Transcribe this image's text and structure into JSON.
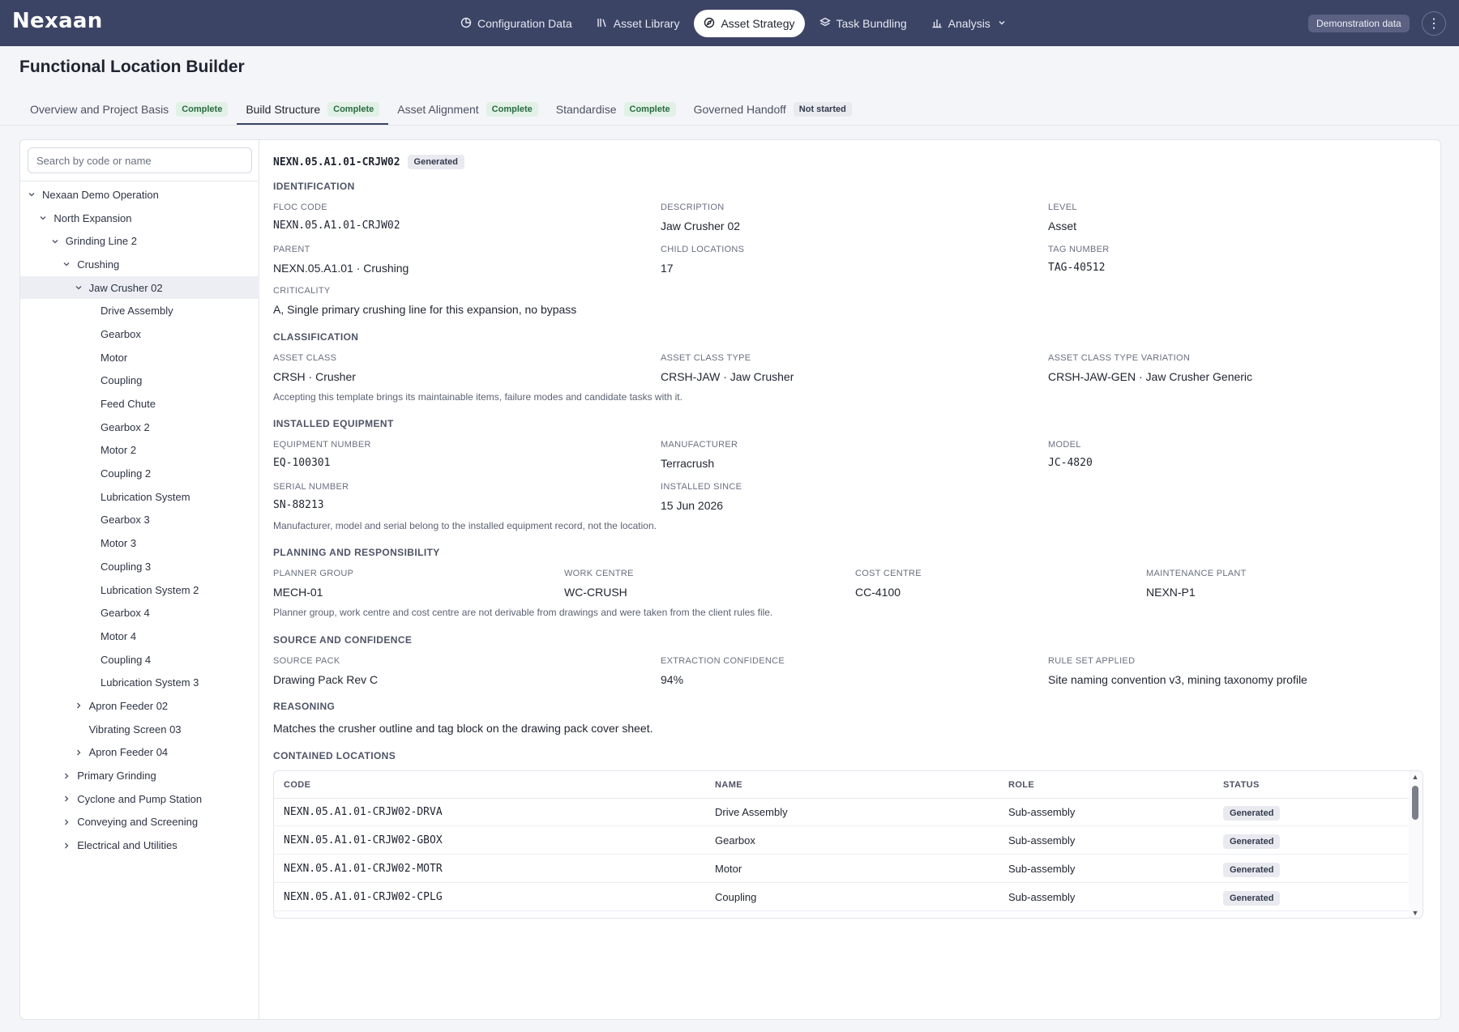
{
  "brand": "Nexaan",
  "nav": [
    {
      "label": "Configuration Data",
      "icon": "chart-pie-icon"
    },
    {
      "label": "Asset Library",
      "icon": "library-icon"
    },
    {
      "label": "Asset Strategy",
      "icon": "compass-icon"
    },
    {
      "label": "Task Bundling",
      "icon": "layers-icon"
    },
    {
      "label": "Analysis",
      "icon": "bar-chart-icon"
    }
  ],
  "demo_badge": "Demonstration data",
  "page_title": "Functional Location Builder",
  "tabs": [
    {
      "label": "Overview and Project Basis",
      "status": "Complete"
    },
    {
      "label": "Build Structure",
      "status": "Complete"
    },
    {
      "label": "Asset Alignment",
      "status": "Complete"
    },
    {
      "label": "Standardise",
      "status": "Complete"
    },
    {
      "label": "Governed Handoff",
      "status": "Not started"
    }
  ],
  "search": {
    "placeholder": "Search by code or name",
    "value": ""
  },
  "tree": [
    {
      "label": "Nexaan Demo Operation",
      "depth": 0,
      "toggle": "open"
    },
    {
      "label": "North Expansion",
      "depth": 1,
      "toggle": "open"
    },
    {
      "label": "Grinding Line 2",
      "depth": 2,
      "toggle": "open"
    },
    {
      "label": "Crushing",
      "depth": 3,
      "toggle": "open"
    },
    {
      "label": "Jaw Crusher 02",
      "depth": 4,
      "toggle": "open",
      "selected": true
    },
    {
      "label": "Drive Assembly",
      "depth": 5,
      "toggle": "none"
    },
    {
      "label": "Gearbox",
      "depth": 5,
      "toggle": "none"
    },
    {
      "label": "Motor",
      "depth": 5,
      "toggle": "none"
    },
    {
      "label": "Coupling",
      "depth": 5,
      "toggle": "none"
    },
    {
      "label": "Feed Chute",
      "depth": 5,
      "toggle": "none"
    },
    {
      "label": "Gearbox 2",
      "depth": 5,
      "toggle": "none"
    },
    {
      "label": "Motor 2",
      "depth": 5,
      "toggle": "none"
    },
    {
      "label": "Coupling 2",
      "depth": 5,
      "toggle": "none"
    },
    {
      "label": "Lubrication System",
      "depth": 5,
      "toggle": "none"
    },
    {
      "label": "Gearbox 3",
      "depth": 5,
      "toggle": "none"
    },
    {
      "label": "Motor 3",
      "depth": 5,
      "toggle": "none"
    },
    {
      "label": "Coupling 3",
      "depth": 5,
      "toggle": "none"
    },
    {
      "label": "Lubrication System 2",
      "depth": 5,
      "toggle": "none"
    },
    {
      "label": "Gearbox 4",
      "depth": 5,
      "toggle": "none"
    },
    {
      "label": "Motor 4",
      "depth": 5,
      "toggle": "none"
    },
    {
      "label": "Coupling 4",
      "depth": 5,
      "toggle": "none"
    },
    {
      "label": "Lubrication System 3",
      "depth": 5,
      "toggle": "none"
    },
    {
      "label": "Apron Feeder 02",
      "depth": 4,
      "toggle": "closed"
    },
    {
      "label": "Vibrating Screen 03",
      "depth": 4,
      "toggle": "none"
    },
    {
      "label": "Apron Feeder 04",
      "depth": 4,
      "toggle": "closed"
    },
    {
      "label": "Primary Grinding",
      "depth": 3,
      "toggle": "closed"
    },
    {
      "label": "Cyclone and Pump Station",
      "depth": 3,
      "toggle": "closed"
    },
    {
      "label": "Conveying and Screening",
      "depth": 3,
      "toggle": "closed"
    },
    {
      "label": "Electrical and Utilities",
      "depth": 3,
      "toggle": "closed"
    }
  ],
  "detail": {
    "code": "NEXN.05.A1.01-CRJW02",
    "badge": "Generated",
    "identification": {
      "heading": "IDENTIFICATION",
      "floc_code_label": "FLOC CODE",
      "floc_code": "NEXN.05.A1.01-CRJW02",
      "description_label": "DESCRIPTION",
      "description": "Jaw Crusher 02",
      "level_label": "LEVEL",
      "level": "Asset",
      "parent_label": "PARENT",
      "parent": "NEXN.05.A1.01 · Crushing",
      "child_locations_label": "CHILD LOCATIONS",
      "child_locations": "17",
      "tag_number_label": "TAG NUMBER",
      "tag_number": "TAG-40512",
      "criticality_label": "CRITICALITY",
      "criticality": "A, Single primary crushing line for this expansion, no bypass"
    },
    "classification": {
      "heading": "CLASSIFICATION",
      "asset_class_label": "ASSET CLASS",
      "asset_class": "CRSH · Crusher",
      "asset_class_type_label": "ASSET CLASS TYPE",
      "asset_class_type": "CRSH-JAW · Jaw Crusher",
      "variation_label": "ASSET CLASS TYPE VARIATION",
      "variation": "CRSH-JAW-GEN · Jaw Crusher Generic",
      "note": "Accepting this template brings its maintainable items, failure modes and candidate tasks with it."
    },
    "installed_equipment": {
      "heading": "INSTALLED EQUIPMENT",
      "equipment_number_label": "EQUIPMENT NUMBER",
      "equipment_number": "EQ-100301",
      "manufacturer_label": "MANUFACTURER",
      "manufacturer": "Terracrush",
      "model_label": "MODEL",
      "model": "JC-4820",
      "serial_number_label": "SERIAL NUMBER",
      "serial_number": "SN-88213",
      "installed_since_label": "INSTALLED SINCE",
      "installed_since": "15 Jun 2026",
      "note": "Manufacturer, model and serial belong to the installed equipment record, not the location."
    },
    "planning": {
      "heading": "PLANNING AND RESPONSIBILITY",
      "planner_group_label": "PLANNER GROUP",
      "planner_group": "MECH-01",
      "work_centre_label": "WORK CENTRE",
      "work_centre": "WC-CRUSH",
      "cost_centre_label": "COST CENTRE",
      "cost_centre": "CC-4100",
      "maintenance_plant_label": "MAINTENANCE PLANT",
      "maintenance_plant": "NEXN-P1",
      "note": "Planner group, work centre and cost centre are not derivable from drawings and were taken from the client rules file."
    },
    "source": {
      "heading": "SOURCE AND CONFIDENCE",
      "source_pack_label": "SOURCE PACK",
      "source_pack": "Drawing Pack Rev C",
      "extraction_confidence_label": "EXTRACTION CONFIDENCE",
      "extraction_confidence": "94%",
      "rule_set_label": "RULE SET APPLIED",
      "rule_set": "Site naming convention v3, mining taxonomy profile"
    },
    "reasoning": {
      "heading": "REASONING",
      "text": "Matches the crusher outline and tag block on the drawing pack cover sheet."
    },
    "contained": {
      "heading": "CONTAINED LOCATIONS",
      "columns": [
        "CODE",
        "NAME",
        "ROLE",
        "STATUS"
      ],
      "rows": [
        {
          "code": "NEXN.05.A1.01-CRJW02-DRVA",
          "name": "Drive Assembly",
          "role": "Sub-assembly",
          "status": "Generated"
        },
        {
          "code": "NEXN.05.A1.01-CRJW02-GBOX",
          "name": "Gearbox",
          "role": "Sub-assembly",
          "status": "Generated"
        },
        {
          "code": "NEXN.05.A1.01-CRJW02-MOTR",
          "name": "Motor",
          "role": "Sub-assembly",
          "status": "Generated"
        },
        {
          "code": "NEXN.05.A1.01-CRJW02-CPLG",
          "name": "Coupling",
          "role": "Sub-assembly",
          "status": "Generated"
        }
      ]
    }
  }
}
